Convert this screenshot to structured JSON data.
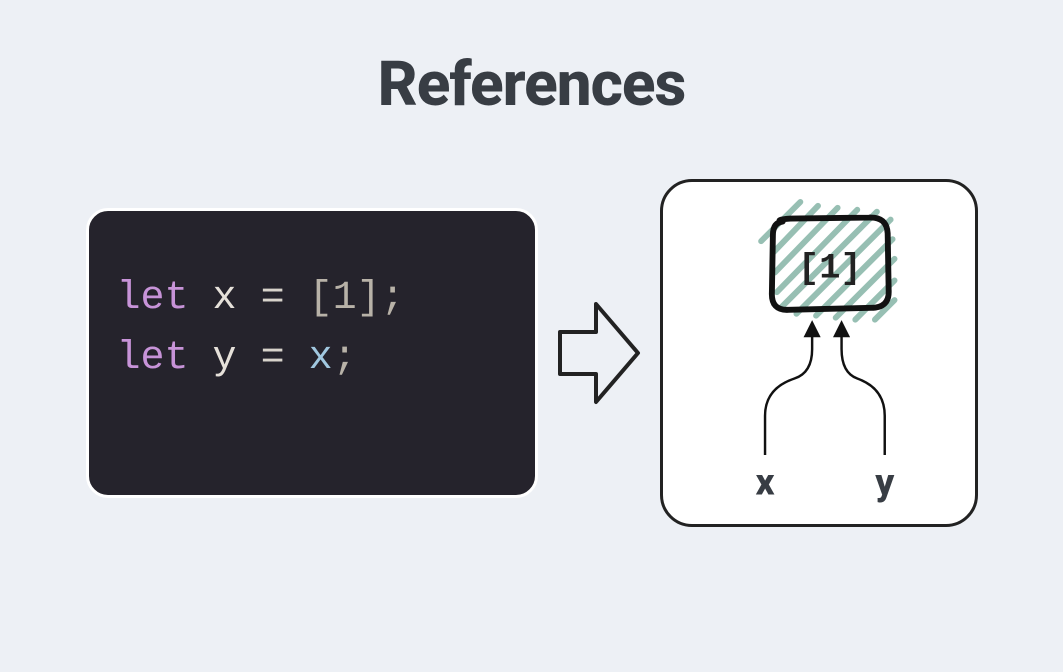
{
  "title": "References",
  "code": {
    "line1": {
      "keyword": "let",
      "ident": "x",
      "eq": "=",
      "open": "[",
      "num": "1",
      "close": "]",
      "semi": ";"
    },
    "line2": {
      "keyword": "let",
      "ident": "y",
      "eq": "=",
      "ref": "x",
      "semi": ";"
    }
  },
  "diagram": {
    "boxLabel": "[1]",
    "varX": "x",
    "varY": "y"
  }
}
